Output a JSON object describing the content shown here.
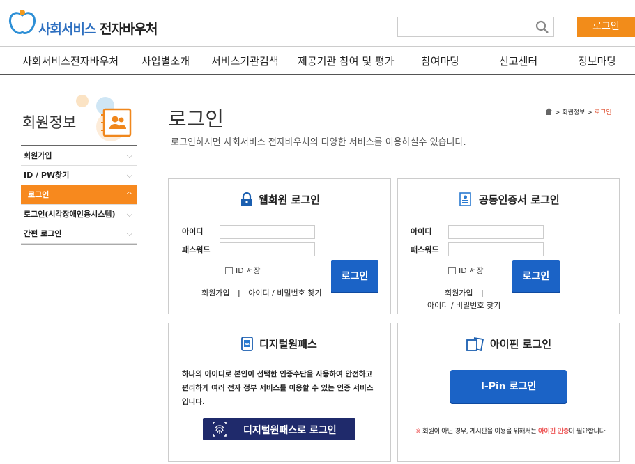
{
  "header": {
    "logo_text_part1": "사회서비스",
    "logo_text_part2": "전자바우처",
    "search_placeholder": "",
    "search_icon": "search-icon",
    "login_label": "로그인"
  },
  "nav": {
    "items": [
      "사회서비스전자바우처",
      "사업별소개",
      "서비스기관검색",
      "제공기관 참여 및 평가",
      "참여마당",
      "신고센터",
      "정보마당"
    ]
  },
  "sidebar": {
    "title": "회원정보",
    "items": [
      {
        "label": "회원가입",
        "active": false
      },
      {
        "label": "ID / PW찾기",
        "active": false
      },
      {
        "label": "로그인",
        "active": true
      },
      {
        "label": "로그인(시각장애인용시스템)",
        "active": false
      },
      {
        "label": "간편 로그인",
        "active": false
      }
    ]
  },
  "main": {
    "title": "로그인",
    "description": "로그인하시면 사회서비스 전자바우처의 다양한 서비스를 이용하실수 있습니다.",
    "breadcrumb": {
      "home_icon": "home-icon",
      "level1": "회원정보",
      "current": "로그인"
    }
  },
  "web_login": {
    "title": "웹회원 로그인",
    "id_label": "아이디",
    "pw_label": "패스워드",
    "save_id": "ID 저장",
    "button": "로그인",
    "join": "회원가입",
    "separator": "|",
    "find": "아이디 / 비밀번호 찾기"
  },
  "cert_login": {
    "title": "공동인증서 로그인",
    "id_label": "아이디",
    "pw_label": "패스워드",
    "save_id": "ID 저장",
    "button": "로그인",
    "join": "회원가입",
    "separator": "|",
    "find": "아이디 / 비밀번호 찾기"
  },
  "digital_pass": {
    "title": "디지털원패스",
    "desc_line1": "하나의 아이디로 본인이 선택한 인증수단을 사용하여 안전하고",
    "desc_line2": "편리하게 여러 전자 정부 서비스를 이용할 수 있는 인증 서비스",
    "desc_line3": "입니다.",
    "button": "디지털원패스로 로그인"
  },
  "ipin": {
    "title": "아이핀 로그인",
    "button": "I-Pin 로그인",
    "note_mark": "※",
    "note_prefix": "회원이 아닌 경우, 게시판을 이용을 위해서는 ",
    "note_highlight": "아이핀 인증",
    "note_suffix": "이 필요합니다."
  },
  "colors": {
    "accent": "#f28c1a",
    "primary_blue": "#1b63c6",
    "navy": "#1f2a6b"
  }
}
